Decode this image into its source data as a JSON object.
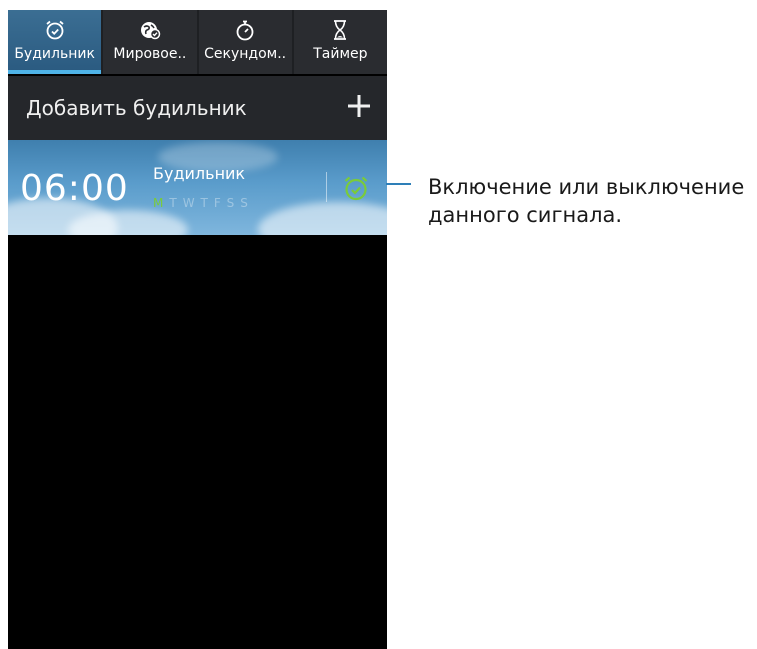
{
  "tabs": [
    {
      "label": "Будильник",
      "icon": "alarm-clock-icon",
      "active": true
    },
    {
      "label": "Мировое..",
      "icon": "world-clock-icon",
      "active": false
    },
    {
      "label": "Секундом..",
      "icon": "stopwatch-icon",
      "active": false
    },
    {
      "label": "Таймер",
      "icon": "hourglass-icon",
      "active": false
    }
  ],
  "add_alarm": {
    "label": "Добавить будильник",
    "icon": "plus-icon"
  },
  "alarm": {
    "time": "06:00",
    "name": "Будильник",
    "days_first": "M",
    "days_rest": "TWTFSS",
    "toggle_icon": "alarm-clock-icon",
    "enabled": true
  },
  "callout": {
    "text": "Включение или выключение данного сигнала."
  },
  "colors": {
    "active_tab": "#3b6e93",
    "tab_indicator": "#4fb3e8",
    "toggle_on": "#7acb3a",
    "callout_line": "#2e7fb8"
  }
}
